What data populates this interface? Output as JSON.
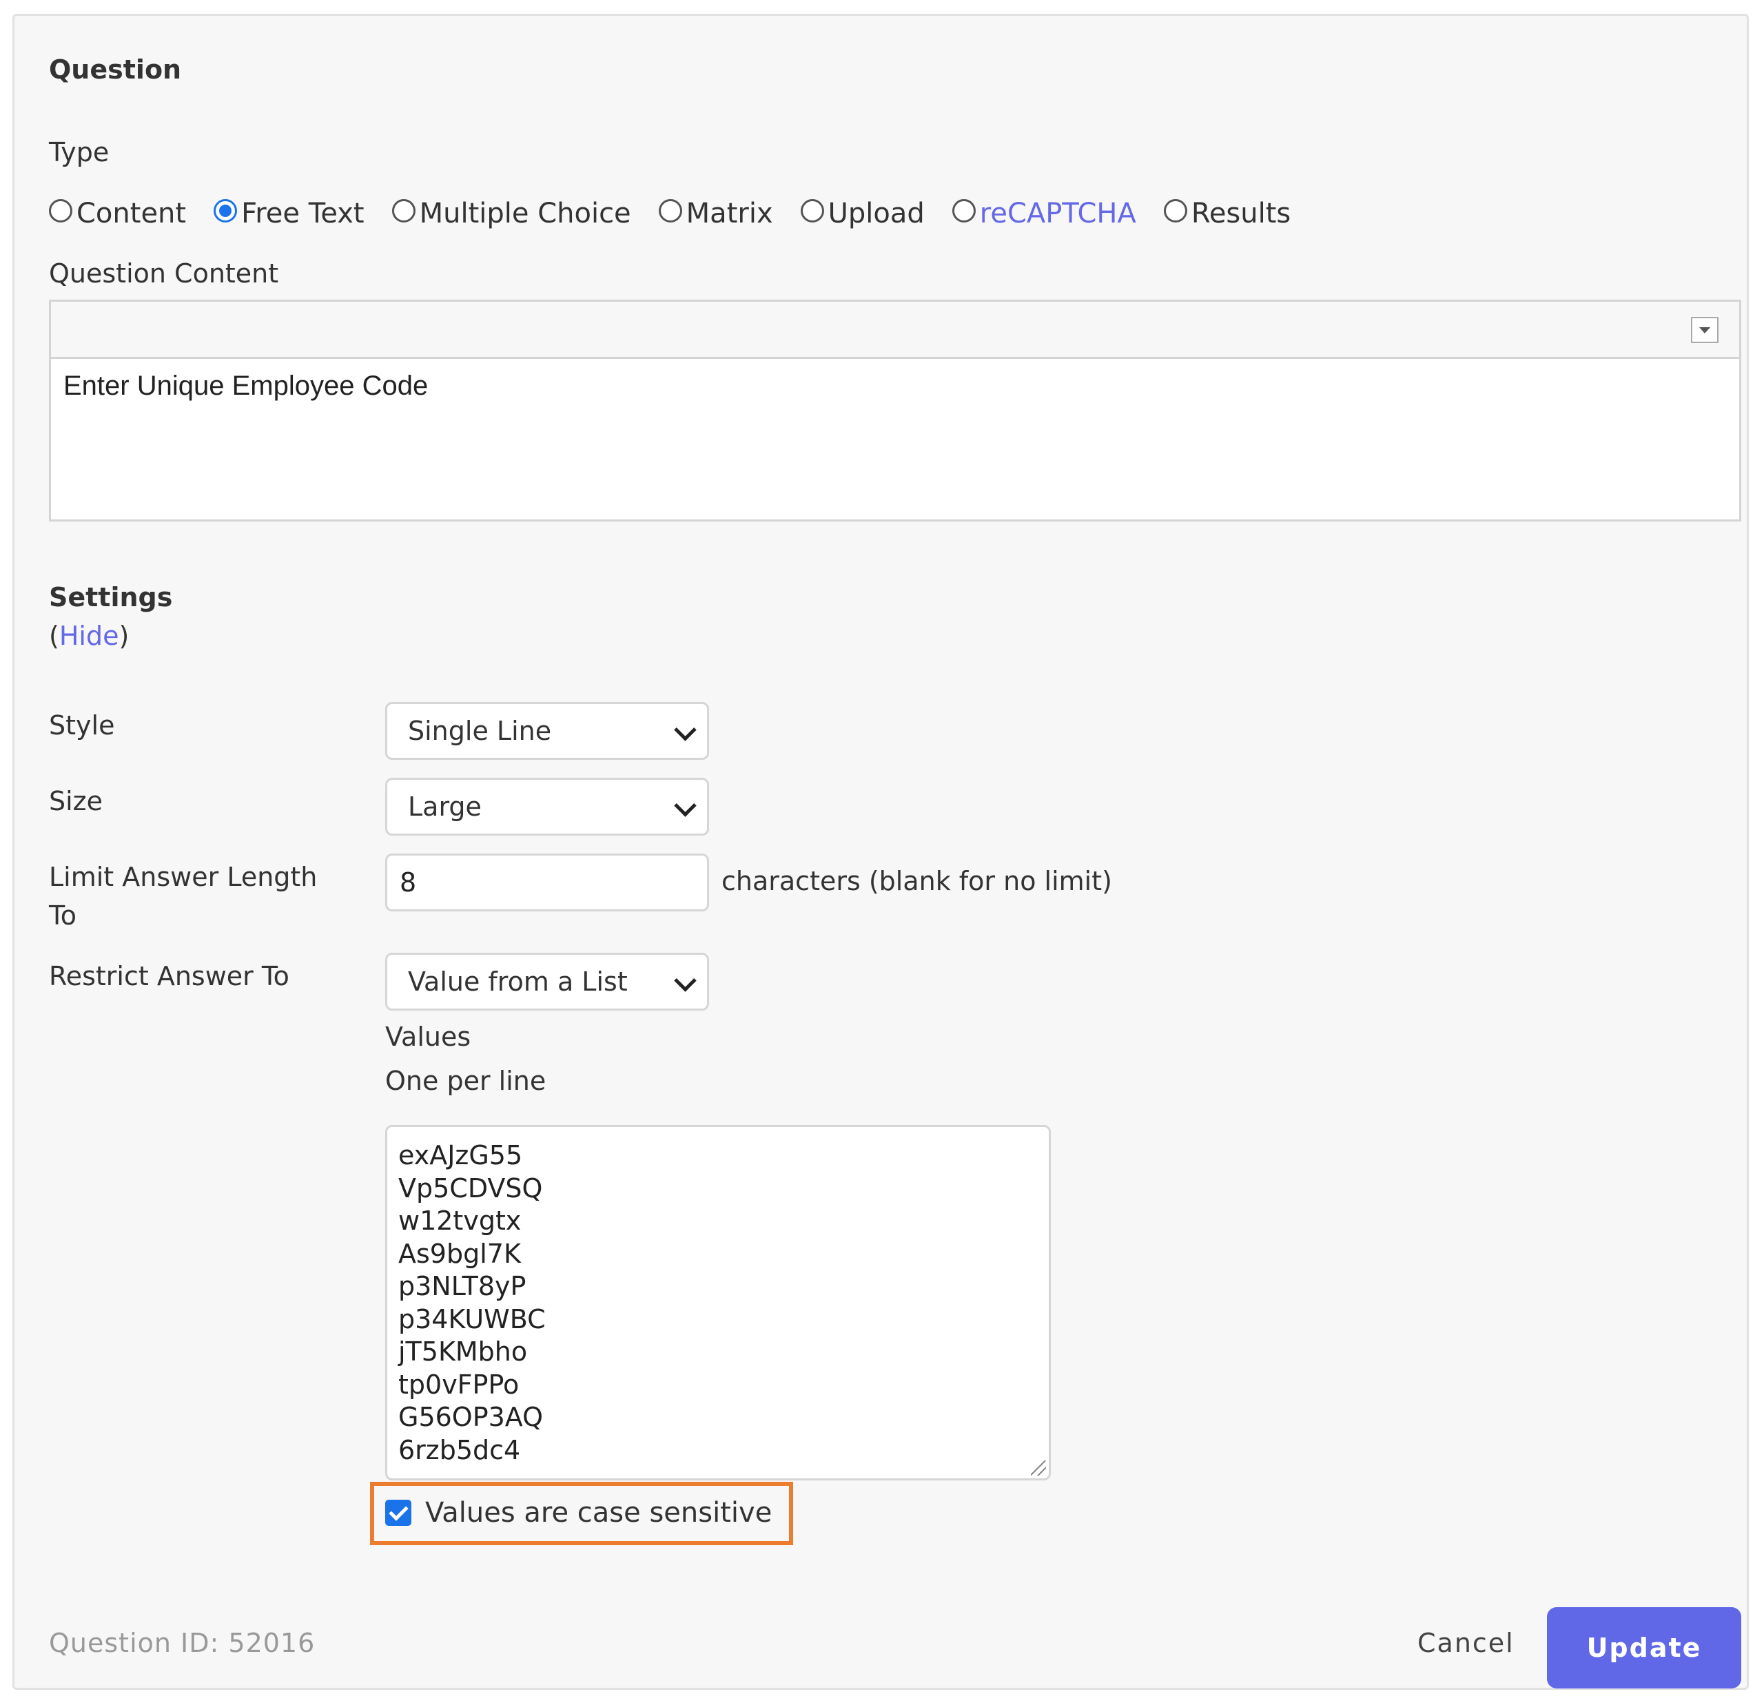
{
  "question": {
    "heading": "Question",
    "type_label": "Type",
    "types": [
      {
        "label": "Content",
        "checked": false
      },
      {
        "label": "Free Text",
        "checked": true
      },
      {
        "label": "Multiple Choice",
        "checked": false
      },
      {
        "label": "Matrix",
        "checked": false
      },
      {
        "label": "Upload",
        "checked": false
      },
      {
        "label": "reCAPTCHA",
        "checked": false
      },
      {
        "label": "Results",
        "checked": false
      }
    ],
    "content_label": "Question Content",
    "content_text": "Enter Unique Employee Code"
  },
  "settings": {
    "heading": "Settings",
    "toggle_open": "(",
    "toggle_link": "Hide",
    "toggle_close": ")",
    "style_label": "Style",
    "style_value": "Single Line",
    "size_label": "Size",
    "size_value": "Large",
    "limit_label_line1": "Limit Answer Length",
    "limit_label_line2": "To",
    "limit_value": "8",
    "limit_suffix": "characters (blank for no limit)",
    "restrict_label": "Restrict Answer To",
    "restrict_value": "Value from a List",
    "values_label": "Values",
    "values_hint": "One per line",
    "values": [
      "exAJzG55",
      "Vp5CDVSQ",
      "w12tvgtx",
      "As9bgl7K",
      "p3NLT8yP",
      "p34KUWBC",
      "jT5KMbho",
      "tp0vFPPo",
      "G56OP3AQ",
      "6rzb5dc4"
    ],
    "case_sensitive_label": "Values are case sensitive",
    "case_sensitive_checked": true
  },
  "footer": {
    "question_id": "Question ID: 52016",
    "cancel_label": "Cancel",
    "update_label": "Update"
  },
  "colors": {
    "accent": "#6168e7",
    "link": "#6469e6",
    "highlight": "#ec7d2f",
    "checkbox": "#1a73e8"
  }
}
